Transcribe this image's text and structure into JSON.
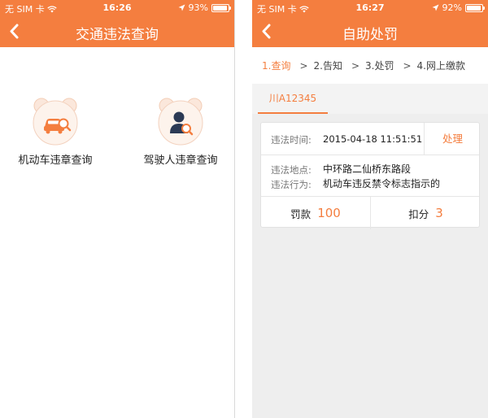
{
  "colors": {
    "accent": "#f47e3f",
    "background": "#eeeeee",
    "card": "#ffffff"
  },
  "screens": [
    {
      "status": {
        "carrier": "无 SIM 卡",
        "time": "16:26",
        "battery": "93%",
        "battery_level": 0.93
      },
      "nav": {
        "title": "交通违法查询",
        "back_icon": "chevron-left-icon"
      },
      "entries": [
        {
          "label": "机动车违章查询",
          "icon": "car-search-icon"
        },
        {
          "label": "驾驶人违章查询",
          "icon": "driver-search-icon"
        }
      ]
    },
    {
      "status": {
        "carrier": "无 SIM 卡",
        "time": "16:27",
        "battery": "92%",
        "battery_level": 0.92
      },
      "nav": {
        "title": "自助处罚",
        "back_icon": "chevron-left-icon"
      },
      "steps": [
        {
          "label": "1.查询",
          "active": true
        },
        {
          "label": "2.告知",
          "active": false
        },
        {
          "label": "3.处罚",
          "active": false
        },
        {
          "label": "4.网上缴款",
          "active": false
        }
      ],
      "step_separator": ">",
      "plate_tab": "川A12345",
      "violation": {
        "time_label": "违法时间:",
        "time_value": "2015-04-18 11:51:51",
        "handle_button": "处理",
        "location_label": "违法地点:",
        "location_value": "中环路二仙桥东路段",
        "behavior_label": "违法行为:",
        "behavior_value": "机动车违反禁令标志指示的",
        "fine_label": "罚款",
        "fine_value": "100",
        "points_label": "扣分",
        "points_value": "3"
      }
    }
  ]
}
